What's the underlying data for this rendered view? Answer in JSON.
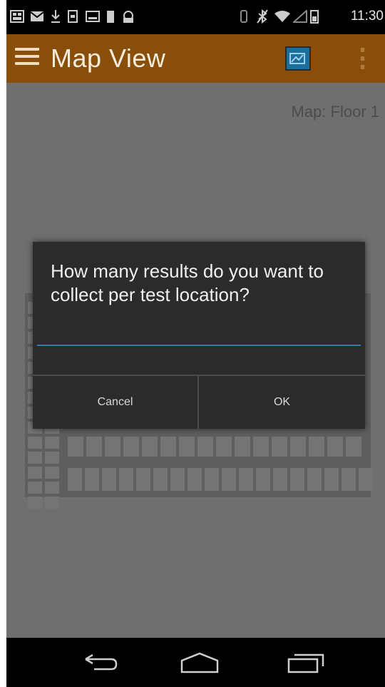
{
  "status_bar": {
    "time": "11:30",
    "left_icons": [
      "sim-card-icon",
      "mail-icon",
      "download-icon",
      "sim-icon",
      "image-icon",
      "battery-full-icon",
      "android-debug-icon"
    ],
    "right_icons": [
      "vibrate-icon",
      "bluetooth-off-icon",
      "wifi-icon",
      "signal-icon",
      "battery-icon"
    ]
  },
  "action_bar": {
    "title": "Map View",
    "menu_icon": "hamburger-menu-icon",
    "action_icon": "map-action-icon",
    "overflow_icon": "overflow-menu-icon",
    "color": "#8a4e0b"
  },
  "content": {
    "map_label": "Map: Floor 1"
  },
  "dialog": {
    "message": "How many results do you want to collect per test location?",
    "input_value": "",
    "cancel_label": "Cancel",
    "ok_label": "OK"
  },
  "nav_bar": {
    "back_icon": "back-icon",
    "home_icon": "home-icon",
    "recents_icon": "recent-apps-icon"
  }
}
